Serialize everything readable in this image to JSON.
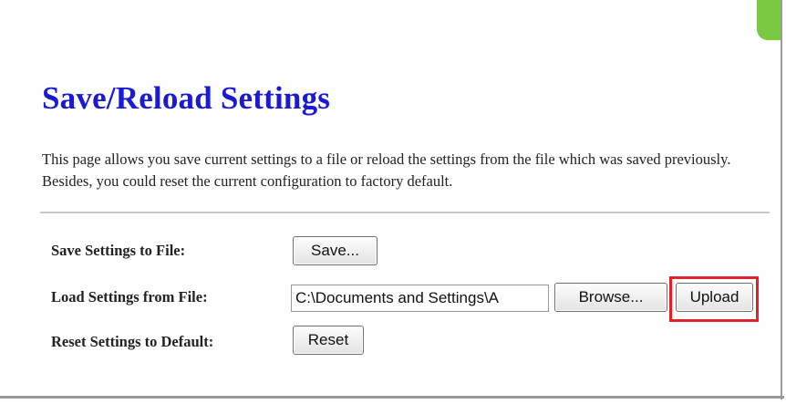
{
  "page": {
    "title": "Save/Reload Settings",
    "description": "This page allows you save current settings to a file or reload the settings from the file which was saved previously. Besides, you could reset the current configuration to factory default."
  },
  "rows": {
    "save": {
      "label": "Save Settings to File:",
      "button": "Save..."
    },
    "load": {
      "label": "Load Settings from File:",
      "file_value": "C:\\Documents and Settings\\A",
      "browse_button": "Browse...",
      "upload_button": "Upload"
    },
    "reset": {
      "label": "Reset Settings to Default:",
      "button": "Reset"
    }
  },
  "colors": {
    "title": "#1a1ad6",
    "highlight": "#e0202a",
    "corner_tab": "#7ac943"
  }
}
